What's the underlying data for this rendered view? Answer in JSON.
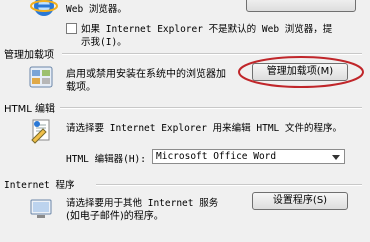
{
  "default_browser": {
    "text_line2": "Web 浏览器。",
    "checkbox_label_line1": "如果 Internet Explorer 不是默认的 Web 浏览器，提",
    "checkbox_label_line2": "示我(I)。"
  },
  "addons": {
    "heading": "管理加载项",
    "description_line1": "启用或禁用安装在系统中的浏览器加",
    "description_line2": "载项。",
    "button_label": "管理加载项(M)"
  },
  "html_editor": {
    "heading": "HTML 编辑",
    "description": "请选择要 Internet Explorer 用来编辑 HTML 文件的程序。",
    "field_label": "HTML 编辑器(H):",
    "selected_value": "Microsoft Office Word"
  },
  "internet_programs": {
    "heading": "Internet 程序",
    "description_line1": "请选择要用于其他 Internet 服务",
    "description_line2": "(如电子邮件)的程序。",
    "button_label": "设置程序(S)"
  },
  "colors": {
    "highlight_ellipse": "#c0262a"
  }
}
